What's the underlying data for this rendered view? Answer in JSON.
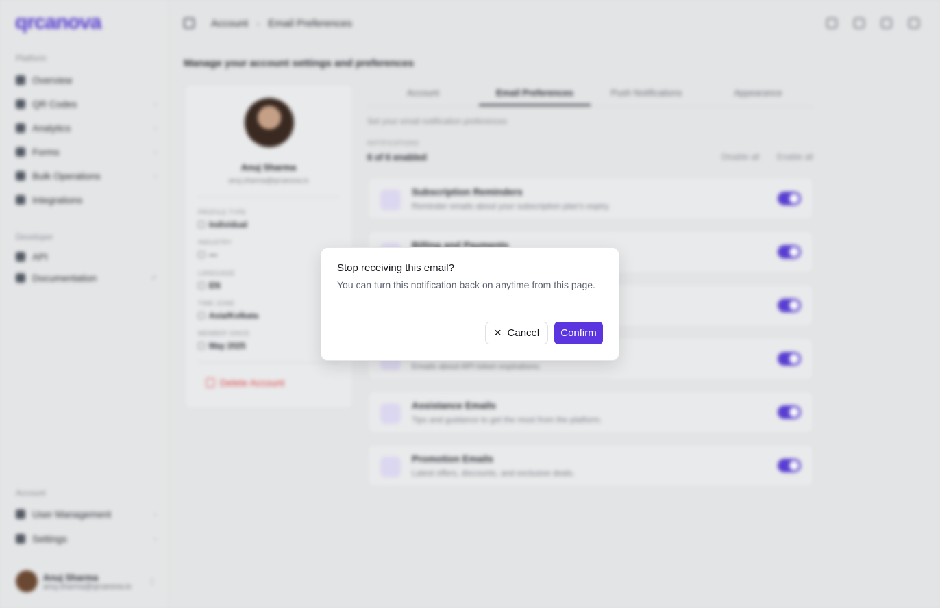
{
  "sidebar": {
    "logo": "qrcanova",
    "platform_label": "Platform",
    "platform_items": [
      {
        "label": "Overview",
        "icon": "grid-icon"
      },
      {
        "label": "QR Codes",
        "icon": "qr-icon"
      },
      {
        "label": "Analytics",
        "icon": "chart-icon"
      },
      {
        "label": "Forms",
        "icon": "form-icon"
      },
      {
        "label": "Bulk Operations",
        "icon": "layers-icon"
      },
      {
        "label": "Integrations",
        "icon": "plug-icon"
      }
    ],
    "developer_label": "Developer",
    "developer_items": [
      {
        "label": "API",
        "icon": "code-icon"
      },
      {
        "label": "Documentation",
        "icon": "book-icon"
      }
    ],
    "account_label": "Account",
    "account_items": [
      {
        "label": "User Management",
        "icon": "users-icon"
      },
      {
        "label": "Settings",
        "icon": "gear-icon"
      }
    ],
    "user": {
      "name": "Anuj Sharma",
      "email": "anuj.sharma@qrcanova.io"
    }
  },
  "header": {
    "breadcrumb": [
      "Account",
      "Email Preferences"
    ]
  },
  "page": {
    "title": "Manage your account settings and preferences",
    "profile": {
      "name": "Anuj Sharma",
      "email": "anuj.sharma@qrcanova.io",
      "fields": [
        {
          "label": "PROFILE TYPE",
          "value": "Individual"
        },
        {
          "label": "INDUSTRY",
          "value": "—"
        },
        {
          "label": "LANGUAGE",
          "value": "EN"
        },
        {
          "label": "TIME ZONE",
          "value": "Asia/Kolkata"
        },
        {
          "label": "MEMBER SINCE",
          "value": "May 2025"
        }
      ],
      "delete_label": "Delete Account"
    },
    "tabs": [
      "Account",
      "Email Preferences",
      "Push Notifications",
      "Appearance"
    ],
    "active_tab": "Email Preferences",
    "subtitle": "Set your email notification preferences",
    "notifications_label": "NOTIFICATIONS",
    "enabled_count": "6 of 6 enabled",
    "disable_all": "Disable all",
    "enable_all": "Enable all",
    "preferences": [
      {
        "title": "Subscription Reminders",
        "desc": "Reminder emails about your subscription plan's expiry.",
        "enabled": true
      },
      {
        "title": "Billing and Payments",
        "desc": "",
        "enabled": true
      },
      {
        "title": "",
        "desc": "",
        "enabled": true
      },
      {
        "title": "",
        "desc": "Emails about API token expirations.",
        "enabled": true
      },
      {
        "title": "Assistance Emails",
        "desc": "Tips and guidance to get the most from the platform.",
        "enabled": true
      },
      {
        "title": "Promotion Emails",
        "desc": "Latest offers, discounts, and exclusive deals.",
        "enabled": true
      }
    ]
  },
  "dialog": {
    "title": "Stop receiving this email?",
    "description": "You can turn this notification back on anytime from this page.",
    "cancel_label": "Cancel",
    "confirm_label": "Confirm"
  },
  "colors": {
    "accent": "#5b35e0",
    "danger": "#e0454a"
  }
}
